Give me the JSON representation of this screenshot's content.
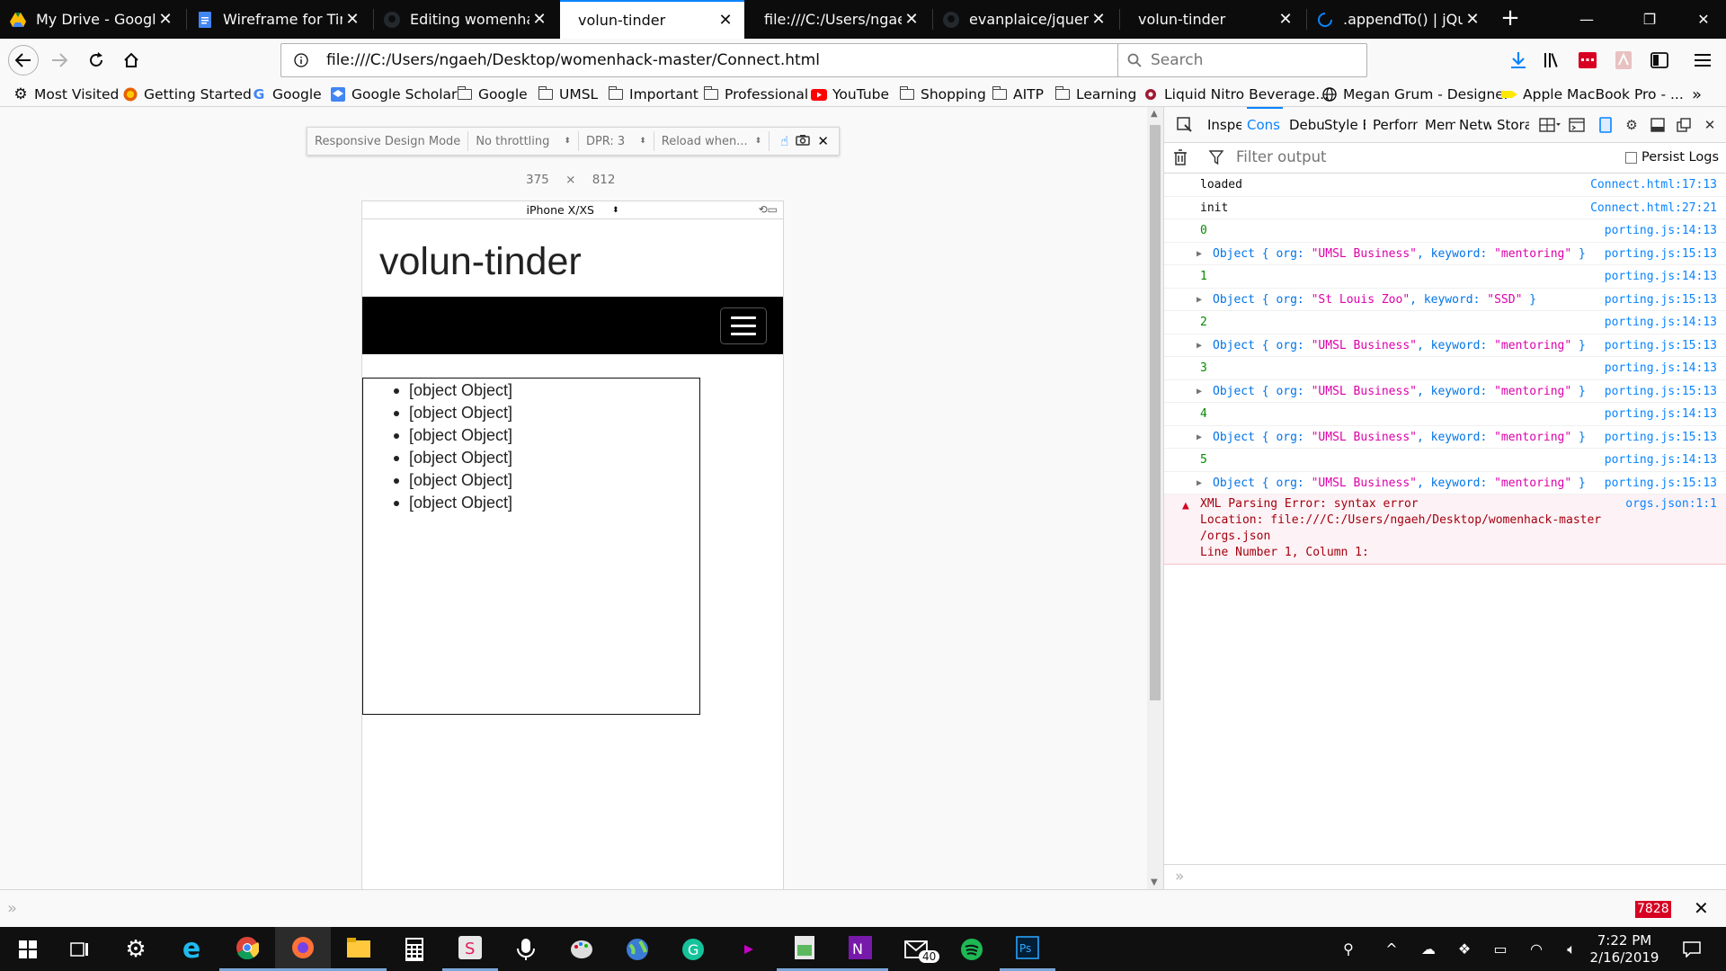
{
  "tabs": [
    {
      "title": "My Drive - Google D",
      "icon": "google-drive-icon",
      "color": "#fbbc04"
    },
    {
      "title": "Wireframe for Tinde",
      "icon": "google-docs-icon",
      "color": "#4285f4"
    },
    {
      "title": "Editing womenhack",
      "icon": "github-icon",
      "color": "#24292e"
    },
    {
      "title": "volun-tinder",
      "icon": "",
      "color": ""
    },
    {
      "title": "file:///C:/Users/ngaeh/D",
      "icon": "",
      "color": ""
    },
    {
      "title": "evanplaice/jquery-c",
      "icon": "github-icon",
      "color": "#24292e"
    },
    {
      "title": "volun-tinder",
      "icon": "",
      "color": ""
    },
    {
      "title": ".appendTo() | jQuery",
      "icon": "loading-icon",
      "color": "#0a84ff"
    }
  ],
  "active_tab_index": 3,
  "navbar": {
    "url": "file:///C:/Users/ngaeh/Desktop/womenhack-master/Connect.html",
    "search_placeholder": "Search"
  },
  "bookmarks": [
    {
      "label": "Most Visited",
      "icon": "gear-icon"
    },
    {
      "label": "Getting Started",
      "icon": "firefox-icon"
    },
    {
      "label": "Google",
      "icon": "google-icon"
    },
    {
      "label": "Google Scholar",
      "icon": "google-scholar-icon"
    },
    {
      "label": "Google",
      "icon": "folder-icon"
    },
    {
      "label": "UMSL",
      "icon": "folder-icon"
    },
    {
      "label": "Important",
      "icon": "folder-icon"
    },
    {
      "label": "Professional",
      "icon": "folder-icon"
    },
    {
      "label": "YouTube",
      "icon": "youtube-icon"
    },
    {
      "label": "Shopping",
      "icon": "folder-icon"
    },
    {
      "label": "AITP",
      "icon": "folder-icon"
    },
    {
      "label": "Learning",
      "icon": "folder-icon"
    },
    {
      "label": "Liquid Nitro Beverage...",
      "icon": "liquid-nitro-icon"
    },
    {
      "label": "Megan Grum - Designer",
      "icon": "globe-icon"
    },
    {
      "label": "Apple MacBook Pro - ...",
      "icon": "apple-tag-icon"
    }
  ],
  "rdm": {
    "mode_label": "Responsive Design Mode",
    "throttling": "No throttling",
    "dpr": "DPR: 3",
    "reload": "Reload when...",
    "width": "375",
    "times": "×",
    "height": "812",
    "device": "iPhone X/XS"
  },
  "site": {
    "title": "volun-tinder",
    "items": [
      "[object Object]",
      "[object Object]",
      "[object Object]",
      "[object Object]",
      "[object Object]",
      "[object Object]"
    ]
  },
  "devtools": {
    "tabs": [
      "Inspe",
      "Cons",
      "Debu",
      "Style E",
      "Perform",
      "Mem",
      "Netw",
      "Stora"
    ],
    "active_tab": "Cons",
    "filter_placeholder": "Filter output",
    "persist_logs": "Persist Logs",
    "logs": [
      {
        "kind": "text",
        "text": "loaded",
        "source": "Connect.html:17:13"
      },
      {
        "kind": "text",
        "text": "init",
        "source": "Connect.html:27:21"
      },
      {
        "kind": "number",
        "text": "0",
        "source": "porting.js:14:13"
      },
      {
        "kind": "object",
        "org": "\"UMSL Business\"",
        "keyword": "\"mentoring\"",
        "source": "porting.js:15:13"
      },
      {
        "kind": "number",
        "text": "1",
        "source": "porting.js:14:13"
      },
      {
        "kind": "object",
        "org": "\"St Louis Zoo\"",
        "keyword": "\"SSD\"",
        "source": "porting.js:15:13"
      },
      {
        "kind": "number",
        "text": "2",
        "source": "porting.js:14:13"
      },
      {
        "kind": "object",
        "org": "\"UMSL Business\"",
        "keyword": "\"mentoring\"",
        "source": "porting.js:15:13"
      },
      {
        "kind": "number",
        "text": "3",
        "source": "porting.js:14:13"
      },
      {
        "kind": "object",
        "org": "\"UMSL Business\"",
        "keyword": "\"mentoring\"",
        "source": "porting.js:15:13"
      },
      {
        "kind": "number",
        "text": "4",
        "source": "porting.js:14:13"
      },
      {
        "kind": "object",
        "org": "\"UMSL Business\"",
        "keyword": "\"mentoring\"",
        "source": "porting.js:15:13"
      },
      {
        "kind": "number",
        "text": "5",
        "source": "porting.js:14:13"
      },
      {
        "kind": "object",
        "org": "\"UMSL Business\"",
        "keyword": "\"mentoring\"",
        "source": "porting.js:15:13"
      }
    ],
    "error": {
      "text": "XML Parsing Error: syntax error\nLocation: file:///C:/Users/ngaeh/Desktop/womenhack-master\n/orgs.json\nLine Number 1, Column 1:",
      "source": "orgs.json:1:1"
    },
    "object_prefix": "Object",
    "object_org_key": "org:",
    "object_keyword_key": "keyword:"
  },
  "statusbar": {
    "badge": "7828"
  },
  "taskbar": {
    "apps": [
      "windows-start-icon",
      "task-view-icon",
      "settings-icon",
      "internet-explorer-icon",
      "chrome-icon",
      "firefox-icon",
      "file-explorer-icon",
      "calculator-icon",
      "slack-icon",
      "voice-recorder-icon",
      "paint-icon",
      "globe-app-icon",
      "grammarly-icon",
      "app-icon",
      "file-icon",
      "onenote-icon",
      "mail-icon",
      "spotify-icon",
      "photoshop-icon"
    ],
    "mail_badge": "40",
    "time": "7:22 PM",
    "date": "2/16/2019"
  },
  "colors": {
    "accent": "#0a84ff",
    "error_bg": "#fdf2f5",
    "console_number": "#058b00",
    "console_string": "#dd00a9",
    "badge_red": "#d70022"
  }
}
